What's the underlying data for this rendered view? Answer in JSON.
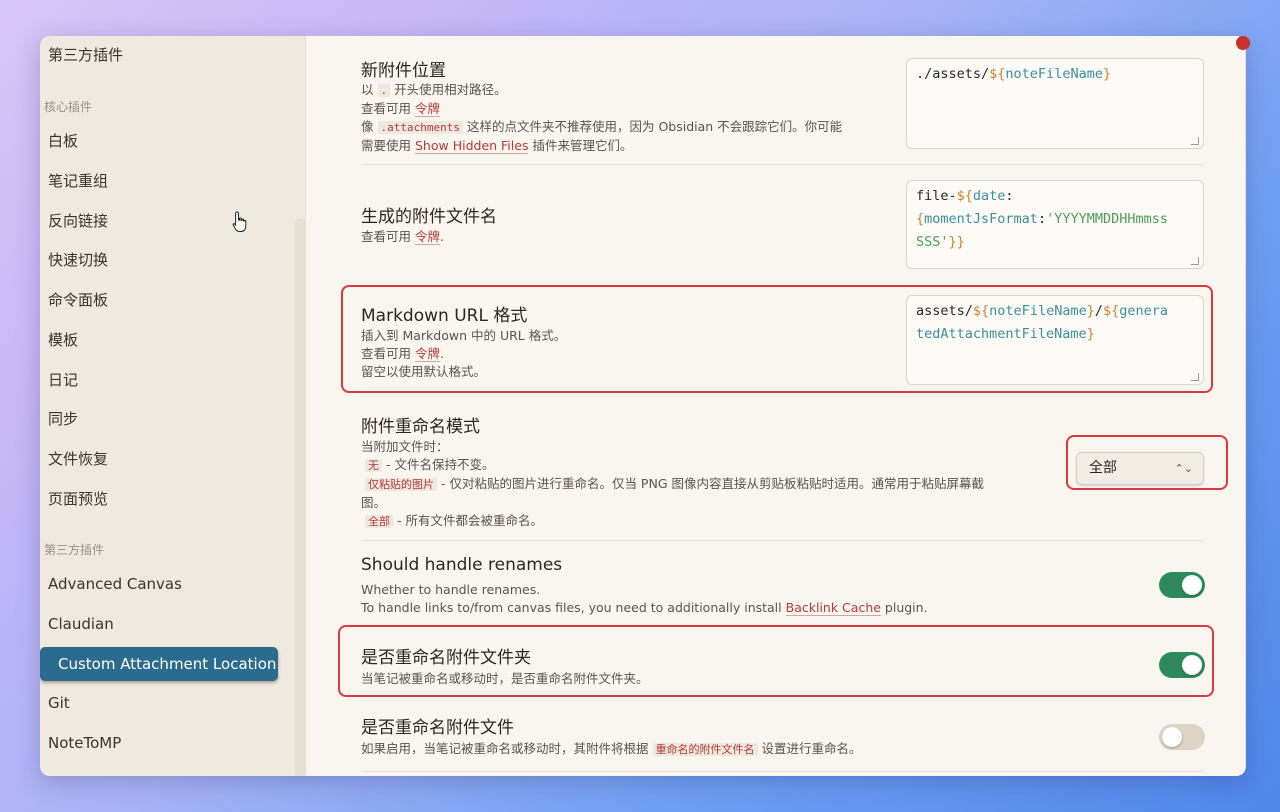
{
  "sidebar": {
    "top_item": "第三方插件",
    "section_core": "核心插件",
    "core_items": [
      "白板",
      "笔记重组",
      "反向链接",
      "快速切换",
      "命令面板",
      "模板",
      "日记",
      "同步",
      "文件恢复",
      "页面预览"
    ],
    "section_third": "第三方插件",
    "third_items": [
      "Advanced Canvas",
      "Claudian"
    ],
    "active_item": "Custom Attachment Location",
    "after_items": [
      "Git",
      "NoteToMP"
    ]
  },
  "settings": {
    "new_attachment_location": {
      "title": "新附件位置",
      "desc_line1_a": "以",
      "desc_line1_code": ".",
      "desc_line1_b": "开头使用相对路径。",
      "desc_line2_a": "查看可用",
      "desc_line2_link": "令牌",
      "desc_line3_a": "像",
      "desc_line3_code": ".attachments",
      "desc_line3_b": "这样的点文件夹不推荐使用，因为 Obsidian 不会跟踪它们。你可能",
      "desc_line4_a": "需要使用",
      "desc_line4_link": "Show Hidden Files",
      "desc_line4_b": "插件来管理它们。",
      "value_prefix": "./assets/",
      "value_dollar": "${",
      "value_key": "noteFileName",
      "value_close": "}"
    },
    "generated_filename": {
      "title": "生成的附件文件名",
      "desc_a": "查看可用",
      "desc_link": "令牌",
      "desc_b": ".",
      "v_prefix": "file-",
      "v_dollar": "${",
      "v_key1": "date",
      "v_colon": ":",
      "v_brace_open": "{",
      "v_key2": "momentJsFormat",
      "v_colon2": ":",
      "v_str1": "'YYYYMMDDHHmmss",
      "v_str2": "SSS'",
      "v_close": "}}"
    },
    "markdown_url": {
      "title": "Markdown URL 格式",
      "desc_line1": "插入到 Markdown 中的 URL 格式。",
      "desc_line2_a": "查看可用",
      "desc_line2_link": "令牌",
      "desc_line2_b": ".",
      "desc_line3": "留空以使用默认格式。",
      "v_prefix": "assets/",
      "v_dollar1": "${",
      "v_key1": "noteFileName",
      "v_close1": "}",
      "v_slash": "/",
      "v_dollar2": "${",
      "v_key2a": "genera",
      "v_key2b": "tedAttachmentFileName",
      "v_close2": "}"
    },
    "rename_mode": {
      "title": "附件重命名模式",
      "desc_line1": "当附加文件时：",
      "opt1_code": "无",
      "opt1_text": "- 文件名保持不变。",
      "opt2_code": "仅粘贴的图片",
      "opt2_text": "- 仅对粘贴的图片进行重命名。仅当 PNG 图像内容直接从剪贴板粘贴时适用。通常用于粘贴屏幕截",
      "opt2_text2": "图。",
      "opt3_code": "全部",
      "opt3_text": "- 所有文件都会被重命名。",
      "selected": "全部"
    },
    "handle_renames": {
      "title": "Should handle renames",
      "desc_line1": "Whether to handle renames.",
      "desc_line2_a": "To handle links to/from canvas files, you need to additionally install",
      "desc_line2_link": "Backlink Cache",
      "desc_line2_b": "plugin.",
      "enabled": true
    },
    "rename_folder": {
      "title": "是否重命名附件文件夹",
      "desc": "当笔记被重命名或移动时，是否重命名附件文件夹。",
      "enabled": true
    },
    "rename_files": {
      "title": "是否重命名附件文件",
      "desc_a": "如果启用，当笔记被重命名或移动时，其附件将根据",
      "desc_code": "重命名的附件文件名",
      "desc_b": "设置进行重命名。",
      "enabled": false
    }
  },
  "colors": {
    "accent": "#2b6b8e",
    "highlight": "#d9393f",
    "toggle_on": "#2f8a5b",
    "link": "#b43a3a"
  }
}
